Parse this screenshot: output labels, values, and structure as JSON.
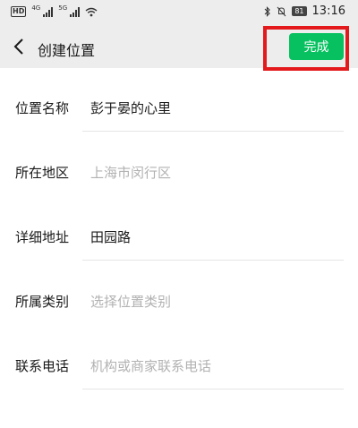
{
  "status_bar": {
    "hd_badge": "HD",
    "net_left": "4G",
    "net_right": "5G",
    "battery": "81",
    "time": "13:16"
  },
  "header": {
    "title": "创建位置",
    "done_label": "完成",
    "accent_color": "#07c160",
    "highlight_color": "#e3191c"
  },
  "form": {
    "rows": [
      {
        "label": "位置名称",
        "value": "彭于晏的心里",
        "is_placeholder": false
      },
      {
        "label": "所在地区",
        "value": "上海市闵行区",
        "is_placeholder": true
      },
      {
        "label": "详细地址",
        "value": "田园路",
        "is_placeholder": false
      },
      {
        "label": "所属类别",
        "value": "选择位置类别",
        "is_placeholder": true
      },
      {
        "label": "联系电话",
        "value": "机构或商家联系电话",
        "is_placeholder": true
      }
    ]
  }
}
